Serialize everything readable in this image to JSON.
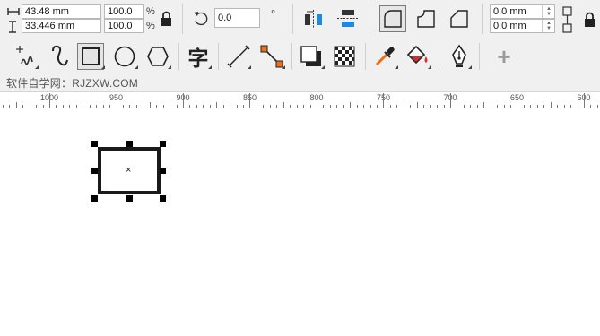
{
  "property_bar": {
    "width_value": "43.48 mm",
    "height_value": "33.446 mm",
    "scale_x_value": "100.0",
    "scale_y_value": "100.0",
    "percent_symbol": "%",
    "rotation_value": "0.0",
    "degree_symbol": "°",
    "corner_radius_top": "0.0 mm",
    "corner_radius_bottom": "0.0 mm"
  },
  "toolbox": {
    "text_tool_glyph": "字",
    "add_tool_glyph": "+"
  },
  "watermark": {
    "text": "软件自学网：RJZXW.COM"
  },
  "ruler": {
    "labels": [
      "1000",
      "950",
      "900",
      "850",
      "800",
      "750",
      "700",
      "650",
      "600"
    ]
  },
  "colors": {
    "toolbar_bg": "#f0f0f0",
    "accent_blue": "#1e88e5",
    "accent_orange": "#e8711a",
    "accent_red": "#d32f2f",
    "rectangle_stroke": "#1a1a1a"
  }
}
